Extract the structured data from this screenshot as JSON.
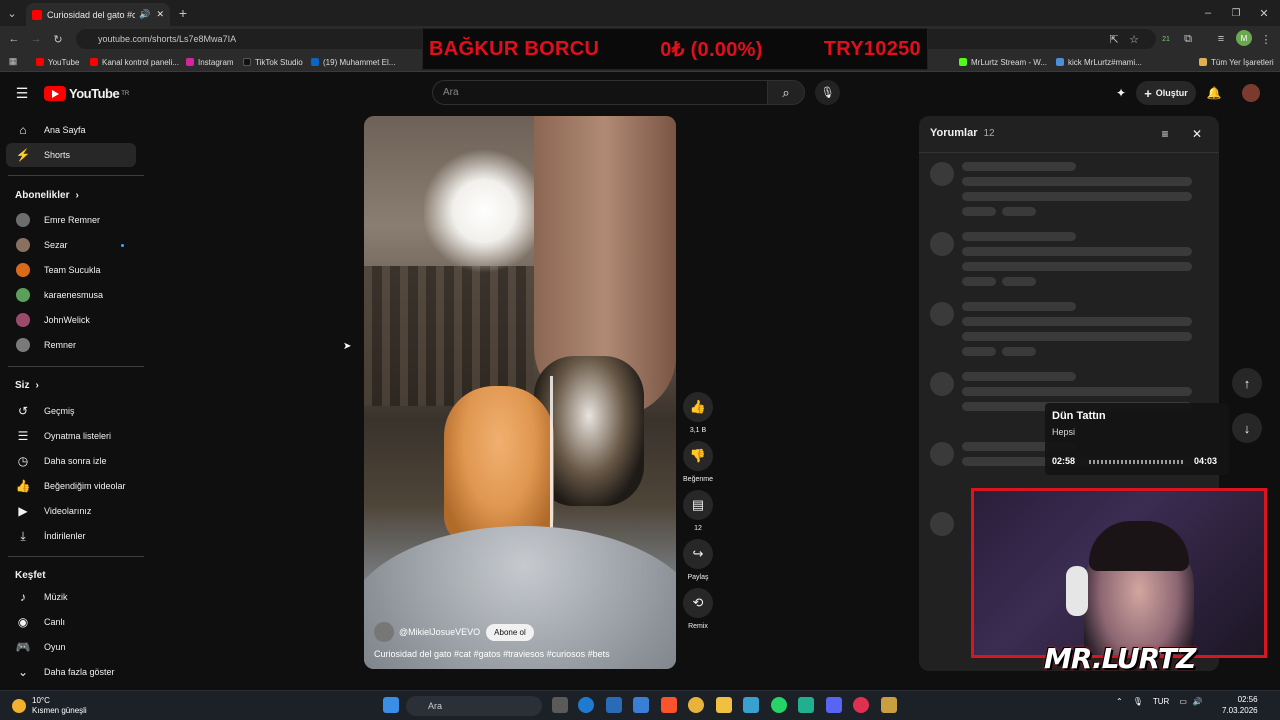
{
  "browser": {
    "tab_title": "Curiosidad del gato #cat #g",
    "url": "youtube.com/shorts/Ls7e8Mwa7IA",
    "bookmarks": [
      "YouTube",
      "Kanal kontrol paneli...",
      "Instagram",
      "TikTok Studio",
      "(19) Muhammet El...",
      "MrLurtz Stream - W...",
      "kick MrLurtz#mami...",
      "Tüm Yer İşaretleri"
    ],
    "ext_badge": "21",
    "profile_initial": "M"
  },
  "ticker": {
    "label": "BAĞKUR BORCU",
    "change": "0₺ (0.00%)",
    "amount": "TRY10250"
  },
  "masthead": {
    "logo": "YouTube",
    "region": "TR",
    "search_placeholder": "Ara",
    "create_label": "Oluştur"
  },
  "sidebar": {
    "main": [
      "Ana Sayfa",
      "Shorts"
    ],
    "subs_header": "Abonelikler",
    "subscriptions": [
      "Emre Remner",
      "Sezar",
      "Team Sucukla",
      "karaenesmusa",
      "JohnWelick",
      "Remner"
    ],
    "you_header": "Siz",
    "you": [
      "Geçmiş",
      "Oynatma listeleri",
      "Daha sonra izle",
      "Beğendiğim videolar",
      "Videolarınız",
      "İndirilenler"
    ],
    "explore_header": "Keşfet",
    "explore": [
      "Müzik",
      "Canlı",
      "Oyun",
      "Daha fazla göster"
    ]
  },
  "short": {
    "channel": "@MikielJosueVEVO",
    "subscribe": "Abone ol",
    "caption": "Curiosidad del gato #cat #gatos #traviesos #curiosos #bets"
  },
  "actions": {
    "likes": "3,1 B",
    "dislike": "Beğenme",
    "comments": "12",
    "share": "Paylaş",
    "remix": "Remix"
  },
  "comments_panel": {
    "title": "Yorumlar",
    "count": "12"
  },
  "music_widget": {
    "title": "Dün Tattın",
    "subtitle": "Hepsi",
    "elapsed": "02:58",
    "total": "04:03"
  },
  "cam_logo": "MR.LURTZ",
  "taskbar": {
    "temp": "10°C",
    "weather": "Kısmen güneşli",
    "search": "Ara",
    "lang": "TUR",
    "time": "02:56",
    "date": "7.03.2026"
  },
  "colors": {
    "accent": "#ff0000",
    "ticker_red": "#e10f1b",
    "cam_border": "#d91520",
    "background": "#0f0f0f"
  }
}
